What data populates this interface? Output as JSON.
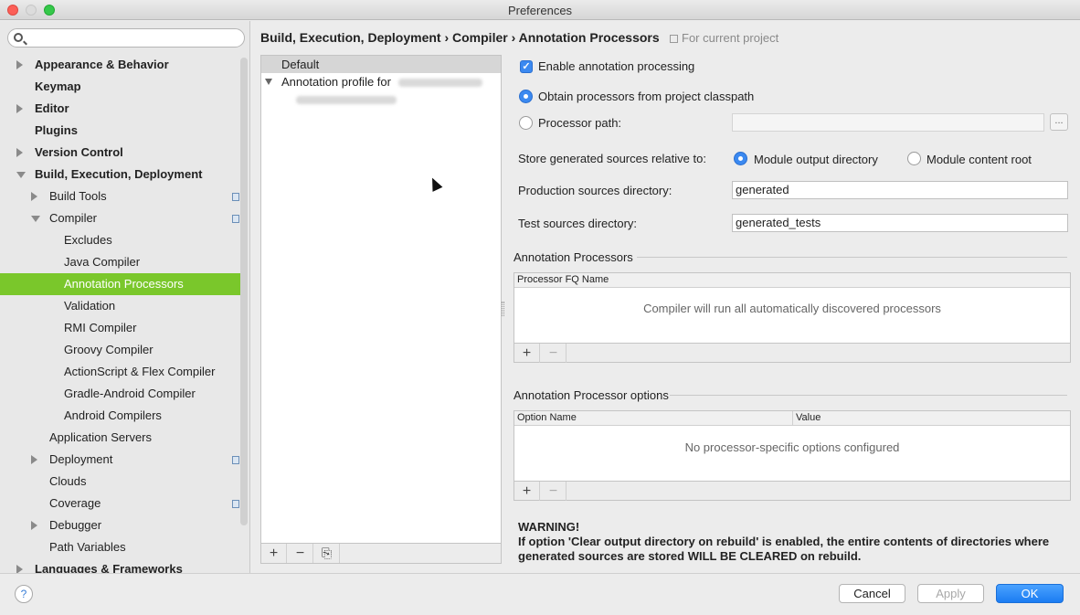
{
  "window": {
    "title": "Preferences"
  },
  "sidebar": {
    "search_placeholder": "",
    "items": [
      {
        "label": "Appearance & Behavior",
        "bold": true,
        "level": 0,
        "arrow": "right"
      },
      {
        "label": "Keymap",
        "bold": true,
        "level": 0,
        "arrow": ""
      },
      {
        "label": "Editor",
        "bold": true,
        "level": 0,
        "arrow": "right"
      },
      {
        "label": "Plugins",
        "bold": true,
        "level": 0,
        "arrow": ""
      },
      {
        "label": "Version Control",
        "bold": true,
        "level": 0,
        "arrow": "right"
      },
      {
        "label": "Build, Execution, Deployment",
        "bold": true,
        "level": 0,
        "arrow": "down"
      },
      {
        "label": "Build Tools",
        "level": 1,
        "arrow": "right",
        "project_icon": true
      },
      {
        "label": "Compiler",
        "level": 1,
        "arrow": "down",
        "project_icon": true
      },
      {
        "label": "Excludes",
        "level": 2,
        "arrow": ""
      },
      {
        "label": "Java Compiler",
        "level": 2,
        "arrow": ""
      },
      {
        "label": "Annotation Processors",
        "level": 2,
        "arrow": "",
        "selected": true
      },
      {
        "label": "Validation",
        "level": 2,
        "arrow": ""
      },
      {
        "label": "RMI Compiler",
        "level": 2,
        "arrow": ""
      },
      {
        "label": "Groovy Compiler",
        "level": 2,
        "arrow": ""
      },
      {
        "label": "ActionScript & Flex Compiler",
        "level": 2,
        "arrow": ""
      },
      {
        "label": "Gradle-Android Compiler",
        "level": 2,
        "arrow": ""
      },
      {
        "label": "Android Compilers",
        "level": 2,
        "arrow": ""
      },
      {
        "label": "Application Servers",
        "level": 1,
        "arrow": ""
      },
      {
        "label": "Deployment",
        "level": 1,
        "arrow": "right",
        "project_icon": true
      },
      {
        "label": "Clouds",
        "level": 1,
        "arrow": ""
      },
      {
        "label": "Coverage",
        "level": 1,
        "arrow": "",
        "project_icon": true
      },
      {
        "label": "Debugger",
        "level": 1,
        "arrow": "right"
      },
      {
        "label": "Path Variables",
        "level": 1,
        "arrow": ""
      },
      {
        "label": "Languages & Frameworks",
        "bold": true,
        "level": 0,
        "arrow": "right"
      }
    ]
  },
  "header": {
    "breadcrumb": "Build, Execution, Deployment › Compiler › Annotation Processors",
    "scope": "For current project"
  },
  "profiles": {
    "default_label": "Default",
    "annotation_profile_label": "Annotation profile for",
    "toolbar": {
      "add": "+",
      "remove": "−",
      "move": "⎘"
    }
  },
  "form": {
    "enable_label": "Enable annotation processing",
    "enable_checked": true,
    "obtain_label": "Obtain processors from project classpath",
    "processor_path_label": "Processor path:",
    "processor_path_value": "",
    "browse_label": "...",
    "store_label": "Store generated sources relative to:",
    "module_output_label": "Module output directory",
    "module_content_label": "Module content root",
    "production_label": "Production sources directory:",
    "production_value": "generated",
    "test_label": "Test sources directory:",
    "test_value": "generated_tests"
  },
  "processors_section": {
    "title": "Annotation Processors",
    "column": "Processor FQ Name",
    "empty_text": "Compiler will run all automatically discovered processors",
    "add": "+",
    "remove": "−"
  },
  "options_section": {
    "title": "Annotation Processor options",
    "columns": [
      "Option Name",
      "Value"
    ],
    "empty_text": "No processor-specific options configured",
    "add": "+",
    "remove": "−"
  },
  "warning": {
    "title": "WARNING!",
    "text": "If option 'Clear output directory on rebuild' is enabled, the entire contents of directories where generated sources are stored WILL BE CLEARED on rebuild."
  },
  "footer": {
    "help": "?",
    "cancel": "Cancel",
    "apply": "Apply",
    "ok": "OK"
  },
  "colors": {
    "selection": "#7ac72b",
    "accent": "#3b89f0"
  }
}
